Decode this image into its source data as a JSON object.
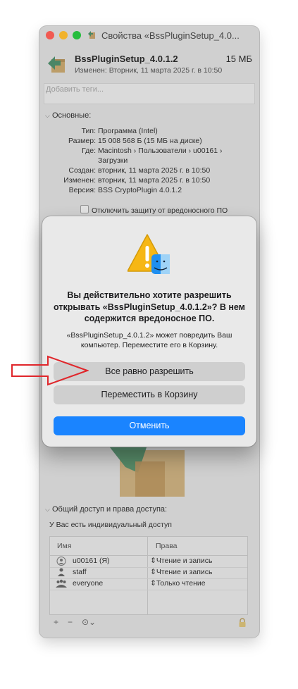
{
  "window": {
    "title": "Свойства «BssPluginSetup_4.0..."
  },
  "file": {
    "name": "BssPluginSetup_4.0.1.2",
    "size": "15 МБ",
    "modified": "Изменен: Вторник, 11 марта 2025 г. в 10:50"
  },
  "tags": {
    "placeholder": "Добавить теги..."
  },
  "general": {
    "header": "Основные:",
    "rows": [
      {
        "label": "Тип:",
        "value": "Программа (Intel)"
      },
      {
        "label": "Размер:",
        "value": "15 008 568 Б (15 МБ на диске)"
      },
      {
        "label": "Где:",
        "value": "Macintosh › Пользователи › u00161 ›"
      },
      {
        "label": "",
        "value": "Загрузки"
      },
      {
        "label": "Создан:",
        "value": "вторник, 11 марта 2025 г. в 10:50"
      },
      {
        "label": "Изменен:",
        "value": "вторник, 11 марта 2025 г. в 10:50"
      },
      {
        "label": "Версия:",
        "value": "BSS CryptoPlugin 4.0.1.2"
      }
    ],
    "checkbox_label": "Отключить защиту от вредоносного ПО"
  },
  "sharing": {
    "header": "Общий доступ и права доступа:",
    "note": "У Вас есть индивидуальный доступ",
    "columns": [
      "Имя",
      "Права"
    ],
    "rows": [
      {
        "name": "u00161 (Я)",
        "privilege": "Чтение и запись",
        "icon": "user-icon"
      },
      {
        "name": "staff",
        "privilege": "Чтение и запись",
        "icon": "group-icon"
      },
      {
        "name": "everyone",
        "privilege": "Только чтение",
        "icon": "everyone-icon"
      }
    ],
    "toolbar": {
      "add": "+",
      "remove": "−",
      "actions": "⊙⌄"
    }
  },
  "alert": {
    "title": "Вы действительно хотите разрешить открывать «BssPluginSetup_4.0.1.2»? В нем содержится вредоносное ПО.",
    "message": "«BssPluginSetup_4.0.1.2» может повредить Ваш компьютер. Переместите его в Корзину.",
    "buttons": {
      "allow": "Все равно разрешить",
      "trash": "Переместить в Корзину",
      "cancel": "Отменить"
    }
  },
  "colors": {
    "accent": "#1a84ff",
    "annotation_arrow": "#e0262b"
  }
}
